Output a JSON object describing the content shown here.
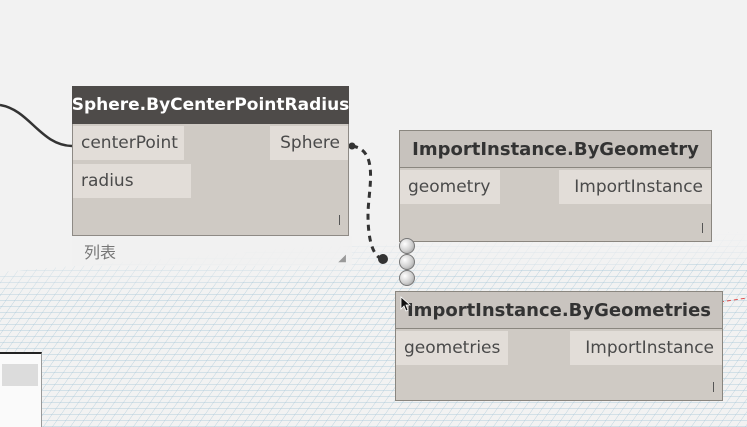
{
  "nodes": {
    "sphere": {
      "title": "Sphere.ByCenterPointRadius",
      "inputs": [
        "centerPoint",
        "radius"
      ],
      "output": "Sphere",
      "footer_mark": "l"
    },
    "import_geometry": {
      "title": "ImportInstance.ByGeometry",
      "input": "geometry",
      "output": "ImportInstance",
      "footer_mark": "l"
    },
    "import_geometries": {
      "title": "ImportInstance.ByGeometries",
      "input": "geometries",
      "output": "ImportInstance",
      "footer_mark": "l"
    }
  },
  "preview": {
    "label": "列表"
  },
  "colors": {
    "header_active": "#4e4b49",
    "header_inactive": "#c7c2bd",
    "node_body": "#cfcac4",
    "port": "#e2ddd8",
    "wire": "#333333",
    "grid": "#9ec3d6"
  }
}
